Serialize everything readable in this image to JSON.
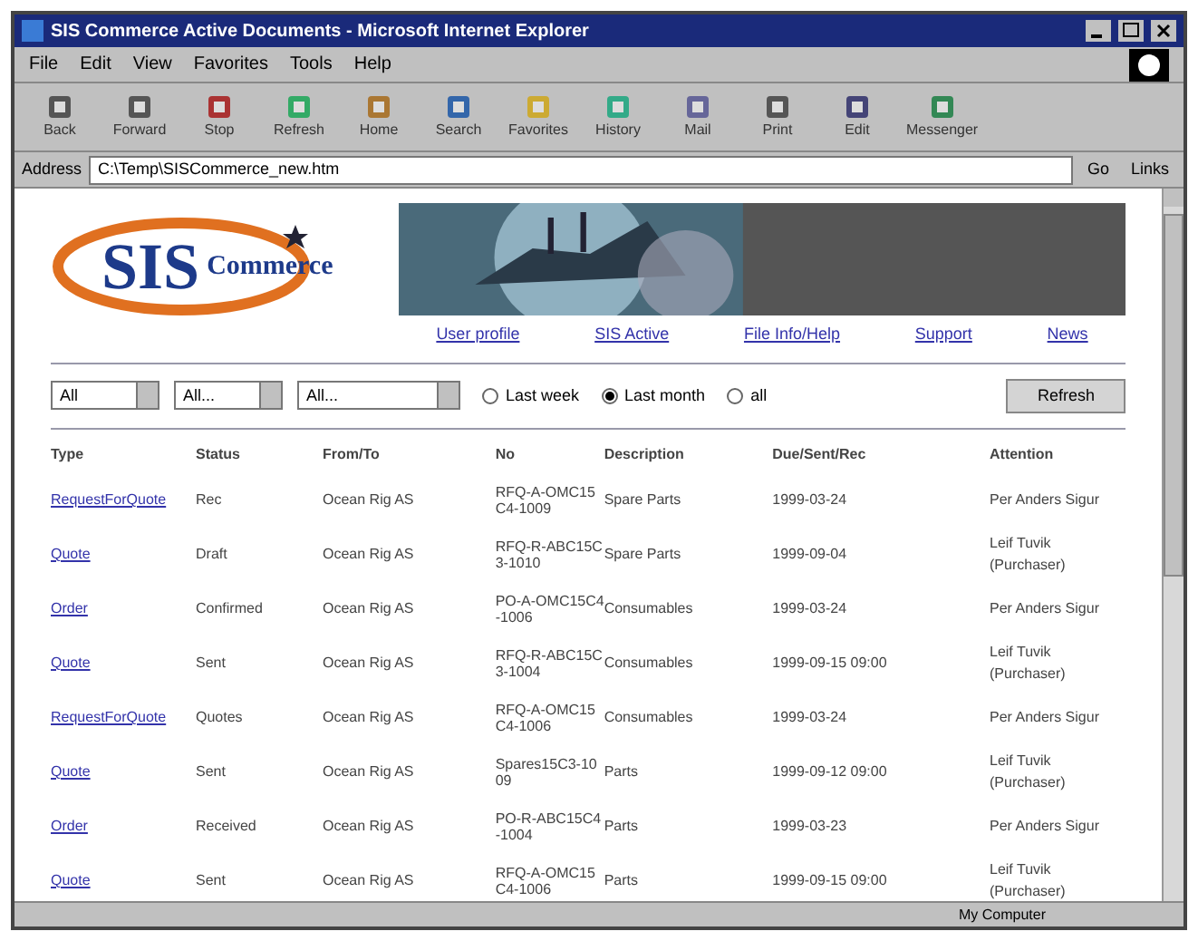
{
  "window": {
    "title": "SIS Commerce Active Documents - Microsoft Internet Explorer"
  },
  "menu": [
    "File",
    "Edit",
    "View",
    "Favorites",
    "Tools",
    "Help"
  ],
  "toolbar": [
    {
      "label": "Back",
      "kind": "back"
    },
    {
      "label": "Forward",
      "kind": "forward"
    },
    {
      "label": "Stop",
      "kind": "stop"
    },
    {
      "label": "Refresh",
      "kind": "refresh"
    },
    {
      "label": "Home",
      "kind": "home"
    },
    {
      "label": "Search",
      "kind": "search"
    },
    {
      "label": "Favorites",
      "kind": "favorites"
    },
    {
      "label": "History",
      "kind": "history"
    },
    {
      "label": "Mail",
      "kind": "mail"
    },
    {
      "label": "Print",
      "kind": "print"
    },
    {
      "label": "Edit",
      "kind": "edit"
    },
    {
      "label": "Messenger",
      "kind": "messenger"
    }
  ],
  "address": {
    "label": "Address",
    "value": "C:\\Temp\\SISCommerce_new.htm",
    "go": "Go",
    "links": "Links"
  },
  "logo": {
    "main": "SIS",
    "sub": "Commerce"
  },
  "nav": [
    "User profile",
    "SIS Active",
    "File Info/Help",
    "Support",
    "News"
  ],
  "filters": {
    "selects": [
      "All",
      "All...",
      "All..."
    ],
    "radios": [
      {
        "label": "Last week",
        "selected": false
      },
      {
        "label": "Last month",
        "selected": true
      },
      {
        "label": "all",
        "selected": false
      }
    ],
    "button": "Refresh"
  },
  "table": {
    "columns": [
      "Type",
      "Status",
      "From/To",
      "No",
      "Description",
      "Due/Sent/Rec",
      "Attention"
    ],
    "rows": [
      [
        "RequestForQuote",
        "Rec",
        "Ocean Rig AS",
        "RFQ-A-OMC15C4-1009",
        "Spare Parts",
        "1999-03-24",
        "Per Anders Sigur"
      ],
      [
        "Quote",
        "Draft",
        "Ocean Rig AS",
        "RFQ-R-ABC15C3-1010",
        "Spare Parts",
        "1999-09-04",
        "Leif Tuvik (Purchaser)"
      ],
      [
        "Order",
        "Confirmed",
        "Ocean Rig AS",
        "PO-A-OMC15C4-1006",
        "Consumables",
        "1999-03-24",
        "Per Anders Sigur"
      ],
      [
        "Quote",
        "Sent",
        "Ocean Rig AS",
        "RFQ-R-ABC15C3-1004",
        "Consumables",
        "1999-09-15 09:00",
        "Leif Tuvik (Purchaser)"
      ],
      [
        "RequestForQuote",
        "Quotes",
        "Ocean Rig AS",
        "RFQ-A-OMC15C4-1006",
        "Consumables",
        "1999-03-24",
        "Per Anders Sigur"
      ],
      [
        "Quote",
        "Sent",
        "Ocean Rig AS",
        "Spares15C3-1009",
        "Parts",
        "1999-09-12 09:00",
        "Leif Tuvik (Purchaser)"
      ],
      [
        "Order",
        "Received",
        "Ocean Rig AS",
        "PO-R-ABC15C4-1004",
        "Parts",
        "1999-03-23",
        "Per Anders Sigur"
      ],
      [
        "Quote",
        "Sent",
        "Ocean Rig AS",
        "RFQ-A-OMC15C4-1006",
        "Parts",
        "1999-09-15 09:00",
        "Leif Tuvik (Purchaser)"
      ]
    ]
  },
  "status_bar": {
    "zone": "My Computer"
  }
}
